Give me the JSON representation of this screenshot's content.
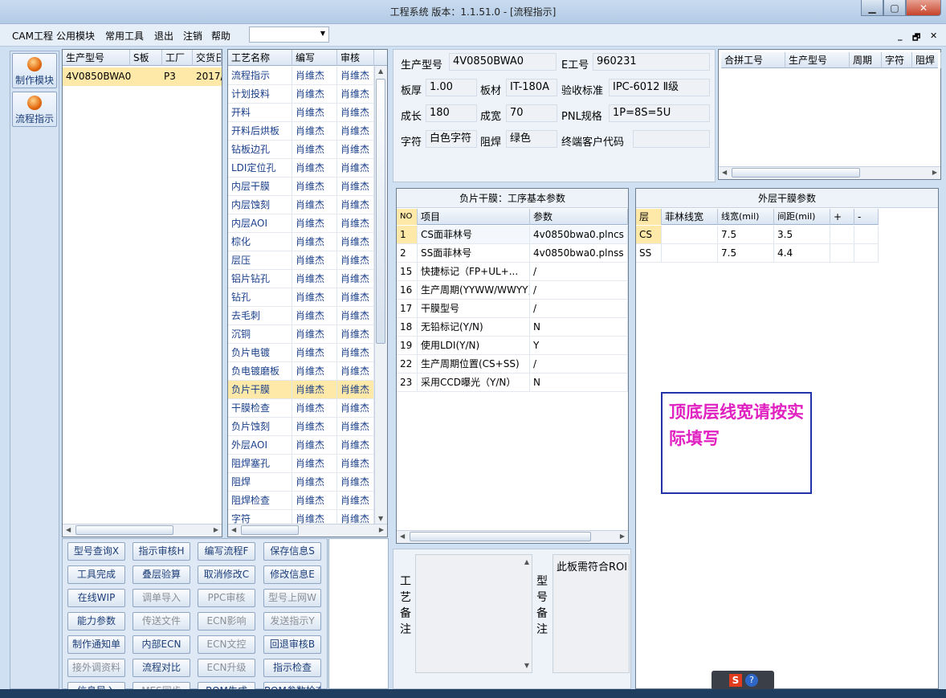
{
  "window": {
    "title": "工程系统  版本：1.1.51.0 - [流程指示]"
  },
  "menu": {
    "items": [
      "CAM工程",
      "公用模块",
      "常用工具",
      "退出",
      "注销",
      "帮助"
    ],
    "combo_value": ""
  },
  "left_nav": {
    "items": [
      {
        "label": "制作模块"
      },
      {
        "label": "流程指示"
      }
    ]
  },
  "model_list": {
    "headers": [
      "生产型号",
      "S板",
      "工厂",
      "交货日"
    ],
    "rows": [
      [
        "4V0850BWA0",
        "",
        "P3",
        "2017/"
      ]
    ]
  },
  "process_list": {
    "headers": [
      "工艺名称",
      "编写",
      "审核"
    ],
    "rows": [
      [
        "流程指示",
        "肖维杰",
        "肖维杰"
      ],
      [
        "计划投料",
        "肖维杰",
        "肖维杰"
      ],
      [
        "开料",
        "肖维杰",
        "肖维杰"
      ],
      [
        "开料后烘板",
        "肖维杰",
        "肖维杰"
      ],
      [
        "钻板边孔",
        "肖维杰",
        "肖维杰"
      ],
      [
        "LDI定位孔",
        "肖维杰",
        "肖维杰"
      ],
      [
        "内层干膜",
        "肖维杰",
        "肖维杰"
      ],
      [
        "内层蚀刻",
        "肖维杰",
        "肖维杰"
      ],
      [
        "内层AOI",
        "肖维杰",
        "肖维杰"
      ],
      [
        "棕化",
        "肖维杰",
        "肖维杰"
      ],
      [
        "层压",
        "肖维杰",
        "肖维杰"
      ],
      [
        "铝片钻孔",
        "肖维杰",
        "肖维杰"
      ],
      [
        "钻孔",
        "肖维杰",
        "肖维杰"
      ],
      [
        "去毛刺",
        "肖维杰",
        "肖维杰"
      ],
      [
        "沉铜",
        "肖维杰",
        "肖维杰"
      ],
      [
        "负片电镀",
        "肖维杰",
        "肖维杰"
      ],
      [
        "负电镀磨板",
        "肖维杰",
        "肖维杰"
      ],
      [
        "负片干膜",
        "肖维杰",
        "肖维杰"
      ],
      [
        "干膜检查",
        "肖维杰",
        "肖维杰"
      ],
      [
        "负片蚀刻",
        "肖维杰",
        "肖维杰"
      ],
      [
        "外层AOI",
        "肖维杰",
        "肖维杰"
      ],
      [
        "阻焊塞孔",
        "肖维杰",
        "肖维杰"
      ],
      [
        "阻焊",
        "肖维杰",
        "肖维杰"
      ],
      [
        "阻焊检查",
        "肖维杰",
        "肖维杰"
      ],
      [
        "字符",
        "肖维杰",
        "肖维杰"
      ]
    ]
  },
  "info": {
    "model_label": "生产型号",
    "model_value": "4V0850BWA0",
    "eno_label": "E工号",
    "eno_value": "960231",
    "thickness_label": "板厚",
    "thickness_value": "1.00",
    "material_label": "板材",
    "material_value": "IT-180A",
    "std_label": "验收标准",
    "std_value": "IPC-6012 Ⅱ级",
    "length_label": "成长",
    "length_value": "180",
    "width_label": "成宽",
    "width_value": "70",
    "pnl_label": "PNL规格",
    "pnl_value": "1P=8S=5U",
    "char_label": "字符",
    "char_value": "白色字符",
    "mask_label": "阻焊",
    "mask_value": "绿色",
    "cust_label": "终端客户代码",
    "cust_value": ""
  },
  "combine_table": {
    "headers": [
      "合拼工号",
      "生产型号",
      "周期",
      "字符",
      "阻焊"
    ]
  },
  "params": {
    "title": "负片干膜：工序基本参数",
    "headers": [
      "NO",
      "项目",
      "参数"
    ],
    "rows": [
      [
        "1",
        "CS面菲林号",
        "4v0850bwa0.plncs"
      ],
      [
        "2",
        "SS面菲林号",
        "4v0850bwa0.plnss"
      ],
      [
        "15",
        "快捷标记（FP+UL+...",
        "/"
      ],
      [
        "16",
        "生产周期(YYWW/WWYY)",
        "/"
      ],
      [
        "17",
        "干膜型号",
        "/"
      ],
      [
        "18",
        "无铅标记(Y/N)",
        "N"
      ],
      [
        "19",
        "使用LDI(Y/N)",
        "Y"
      ],
      [
        "22",
        "生产周期位置(CS+SS)",
        "/"
      ],
      [
        "23",
        "采用CCD曝光（Y/N）",
        "N"
      ]
    ]
  },
  "outer": {
    "title": "外层干膜参数",
    "headers": [
      "层",
      "菲林线宽",
      "线宽(mil)",
      "间距(mil)",
      "+",
      "-"
    ],
    "rows": [
      [
        "CS",
        "",
        "7.5",
        "3.5"
      ],
      [
        "SS",
        "",
        "7.5",
        "4.4"
      ]
    ],
    "note": "顶底层线宽请按实际填写",
    "note_color": "#e020c0"
  },
  "buttons": [
    [
      "型号查询X",
      "指示审核H",
      "编写流程F",
      "保存信息S"
    ],
    [
      "工具完成",
      "叠层验算",
      "取消修改C",
      "修改信息E"
    ],
    [
      "在线WIP",
      "调单导入",
      "PPC审核",
      "型号上网W"
    ],
    [
      "能力参数",
      "传送文件",
      "ECN影响",
      "发送指示Y"
    ],
    [
      "制作通知单",
      "内部ECN",
      "ECN文控",
      "回退审核B"
    ],
    [
      "接外调资料",
      "流程对比",
      "ECN升级",
      "指示检查"
    ],
    [
      "信息导入",
      "MES同步",
      "BOM生成",
      "BOM参数检查"
    ]
  ],
  "remarks": {
    "process_label": "工艺备注",
    "model_label": "型号备注",
    "model_text": "此板需符合ROI"
  }
}
